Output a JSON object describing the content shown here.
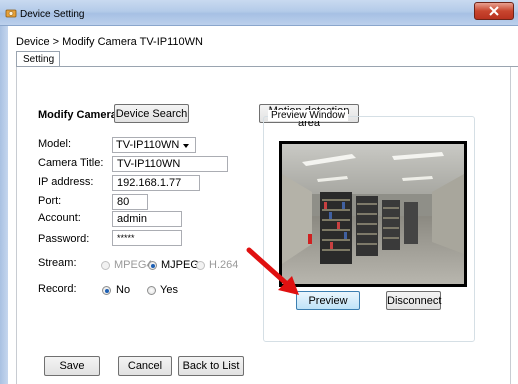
{
  "window": {
    "title": "Device Setting",
    "close_icon": "close-icon",
    "app_icon": "device-setting-icon"
  },
  "breadcrumb": "Device > Modify Camera TV-IP110WN",
  "tabs": [
    {
      "label": "Setting"
    }
  ],
  "form": {
    "heading": "Modify Camera",
    "device_search_label": "Device Search",
    "motion_detection_label": "Motion detection area",
    "model_label": "Model:",
    "model_value": "TV-IP110WN",
    "camera_title_label": "Camera Title:",
    "camera_title_value": "TV-IP110WN",
    "ip_label": "IP address:",
    "ip_value": "192.168.1.77",
    "port_label": "Port:",
    "port_value": "80",
    "account_label": "Account:",
    "account_value": "admin",
    "password_label": "Password:",
    "password_value": "*****",
    "stream_label": "Stream:",
    "stream_options": [
      {
        "label": "MPEG4",
        "selected": false,
        "enabled": false
      },
      {
        "label": "MJPEG",
        "selected": true,
        "enabled": true
      },
      {
        "label": "H.264",
        "selected": false,
        "enabled": false
      }
    ],
    "record_label": "Record:",
    "record_options": [
      {
        "label": "No",
        "selected": true
      },
      {
        "label": "Yes",
        "selected": false
      }
    ]
  },
  "preview_window": {
    "title": "Preview Window",
    "preview_label": "Preview",
    "disconnect_label": "Disconnect"
  },
  "footer": {
    "save_label": "Save",
    "cancel_label": "Cancel",
    "back_label": "Back to List"
  },
  "colors": {
    "annotation_arrow": "#e01010",
    "titlebar": "#b4cbe9",
    "close_button": "#c8452e"
  }
}
